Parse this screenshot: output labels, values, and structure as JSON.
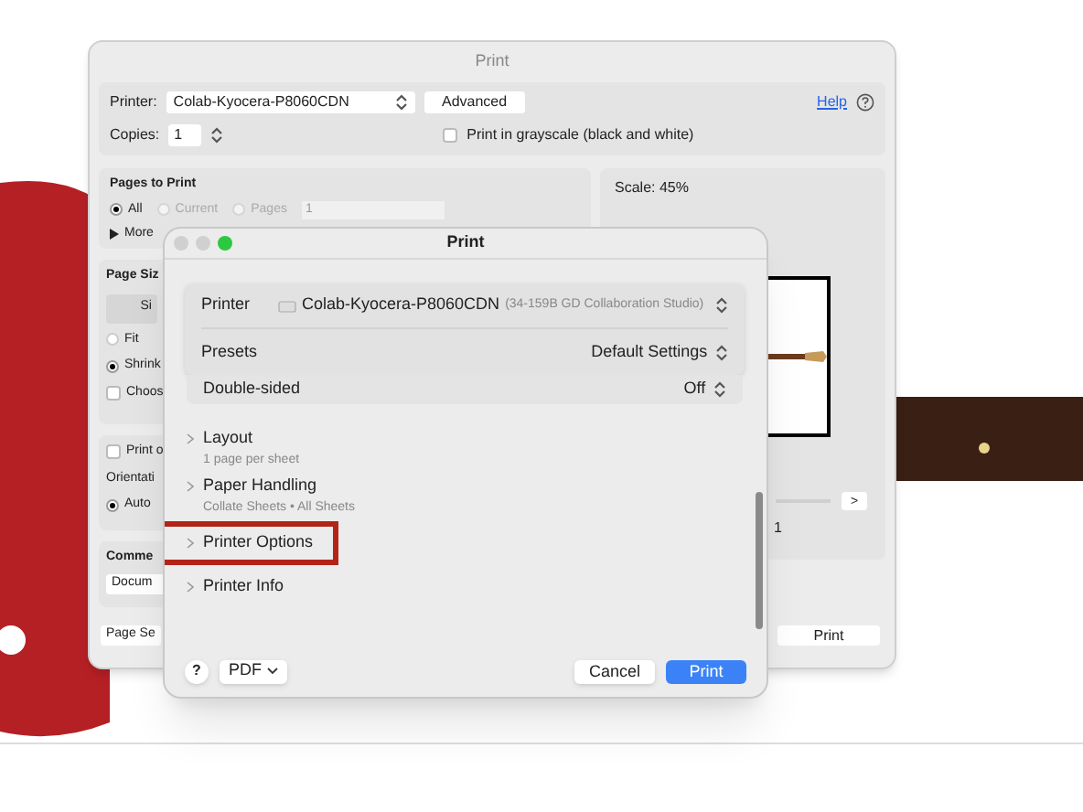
{
  "back_window": {
    "title": "Print",
    "printer_label": "Printer:",
    "printer_value": "Colab-Kyocera-P8060CDN",
    "advanced_button": "Advanced",
    "help_link": "Help",
    "copies_label": "Copies:",
    "copies_value": "1",
    "grayscale": {
      "label": "Print in grayscale (black and white)",
      "checked": false
    },
    "pages_to_print": {
      "title": "Pages to Print",
      "options": [
        {
          "label": "All",
          "selected": true,
          "disabled": false
        },
        {
          "label": "Current",
          "selected": false,
          "disabled": true
        },
        {
          "label": "Pages",
          "selected": false,
          "disabled": true
        }
      ],
      "pages_value": "1",
      "more": "More"
    },
    "page_size": {
      "title": "Page Siz",
      "button": "Si",
      "options": [
        {
          "label": "Fit",
          "kind": "radio",
          "checked": false
        },
        {
          "label": "Shrink",
          "kind": "radio",
          "checked": true
        },
        {
          "label": "Choos",
          "kind": "checkbox",
          "checked": false
        }
      ]
    },
    "print_option": {
      "label": "Print o",
      "checked": false
    },
    "orientation": {
      "label": "Orientati",
      "options": [
        {
          "label": "Auto",
          "selected": true
        }
      ]
    },
    "comments": {
      "title": "Comme",
      "value": "Docum"
    },
    "page_setup_button": "Page Se",
    "scale": "Scale:  45%",
    "page_number": "1",
    "next_button": ">",
    "print_button": "Print"
  },
  "dialog": {
    "title": "Print",
    "printer_label": "Printer",
    "printer_name": "Colab-Kyocera-P8060CDN",
    "printer_location": "(34-159B GD Collaboration Studio)",
    "presets_label": "Presets",
    "presets_value": "Default Settings",
    "double_sided_label": "Double-sided",
    "double_sided_value": "Off",
    "sections": [
      {
        "title": "Layout",
        "summary": "1 page per sheet",
        "highlighted": false
      },
      {
        "title": "Paper Handling",
        "summary": "Collate Sheets • All Sheets",
        "highlighted": false
      },
      {
        "title": "Printer Options",
        "highlighted": true
      },
      {
        "title": "Printer Info",
        "highlighted": false
      }
    ],
    "help_button": "?",
    "pdf_button": "PDF",
    "cancel_button": "Cancel",
    "print_button": "Print"
  }
}
